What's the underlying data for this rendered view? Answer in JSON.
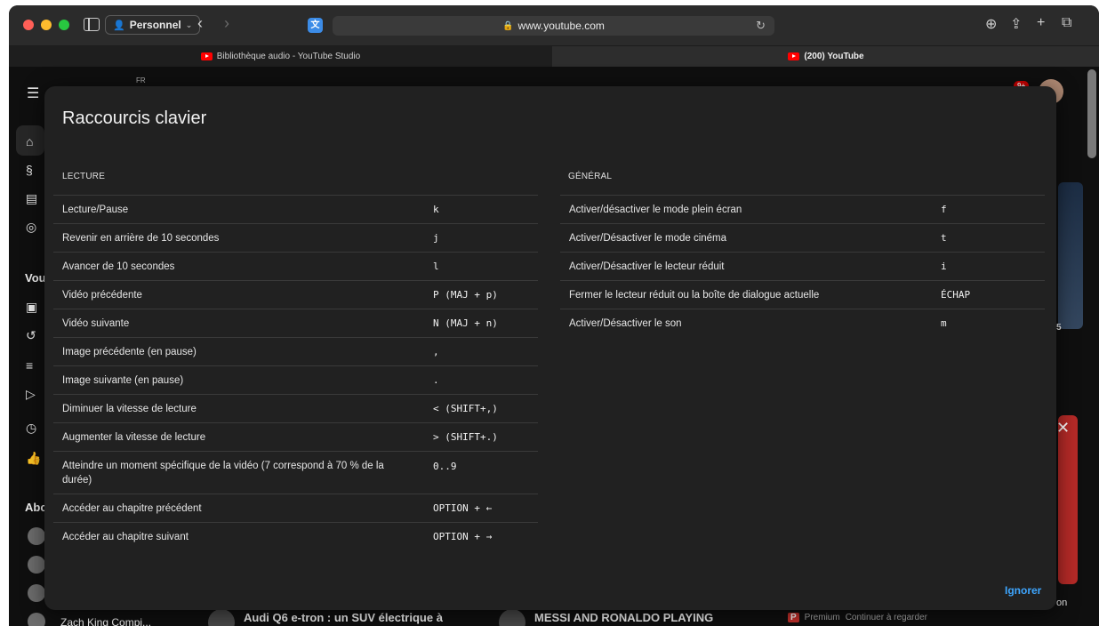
{
  "browser": {
    "profile": "Personnel",
    "url": "www.youtube.com",
    "tabs": [
      {
        "title": "Bibliothèque audio - YouTube Studio",
        "active": false
      },
      {
        "title": "(200) YouTube",
        "active": true
      }
    ]
  },
  "background": {
    "logo_region": "FR",
    "notifications": "9+",
    "section_you": "Vou",
    "section_subs": "Abc",
    "bottom_channel": "Zach King Compi...",
    "bottom_video_1": "Audi Q6 e-tron : un SUV électrique à",
    "bottom_video_2": "MESSI AND RONALDO PLAYING",
    "premium_label": "Premium",
    "continue_label": "Continuer à regarder",
    "right_snippet_count": "5",
    "right_snippet_on": "on"
  },
  "dialog": {
    "title": "Raccourcis clavier",
    "dismiss_label": "Ignorer",
    "playback": {
      "heading": "LECTURE",
      "rows": [
        {
          "label": "Lecture/Pause",
          "key": "k"
        },
        {
          "label": "Revenir en arrière de 10 secondes",
          "key": "j"
        },
        {
          "label": "Avancer de 10 secondes",
          "key": "l"
        },
        {
          "label": "Vidéo précédente",
          "key": "P (MAJ + p)"
        },
        {
          "label": "Vidéo suivante",
          "key": "N (MAJ + n)"
        },
        {
          "label": "Image précédente (en pause)",
          "key": ","
        },
        {
          "label": "Image suivante (en pause)",
          "key": "."
        },
        {
          "label": "Diminuer la vitesse de lecture",
          "key": "< (SHIFT+,)"
        },
        {
          "label": "Augmenter la vitesse de lecture",
          "key": "> (SHIFT+.)"
        },
        {
          "label": "Atteindre un moment spécifique de la vidéo (7 correspond à 70 % de la durée)",
          "key": "0..9"
        },
        {
          "label": "Accéder au chapitre précédent",
          "key": "OPTION + ←"
        },
        {
          "label": "Accéder au chapitre suivant",
          "key": "OPTION + →"
        }
      ]
    },
    "general": {
      "heading": "GÉNÉRAL",
      "rows": [
        {
          "label": "Activer/désactiver le mode plein écran",
          "key": "f"
        },
        {
          "label": "Activer/Désactiver le mode cinéma",
          "key": "t"
        },
        {
          "label": "Activer/Désactiver le lecteur réduit",
          "key": "i"
        },
        {
          "label": "Fermer le lecteur réduit ou la boîte de dialogue actuelle",
          "key": "ÉCHAP"
        },
        {
          "label": "Activer/Désactiver le son",
          "key": "m"
        }
      ]
    }
  }
}
